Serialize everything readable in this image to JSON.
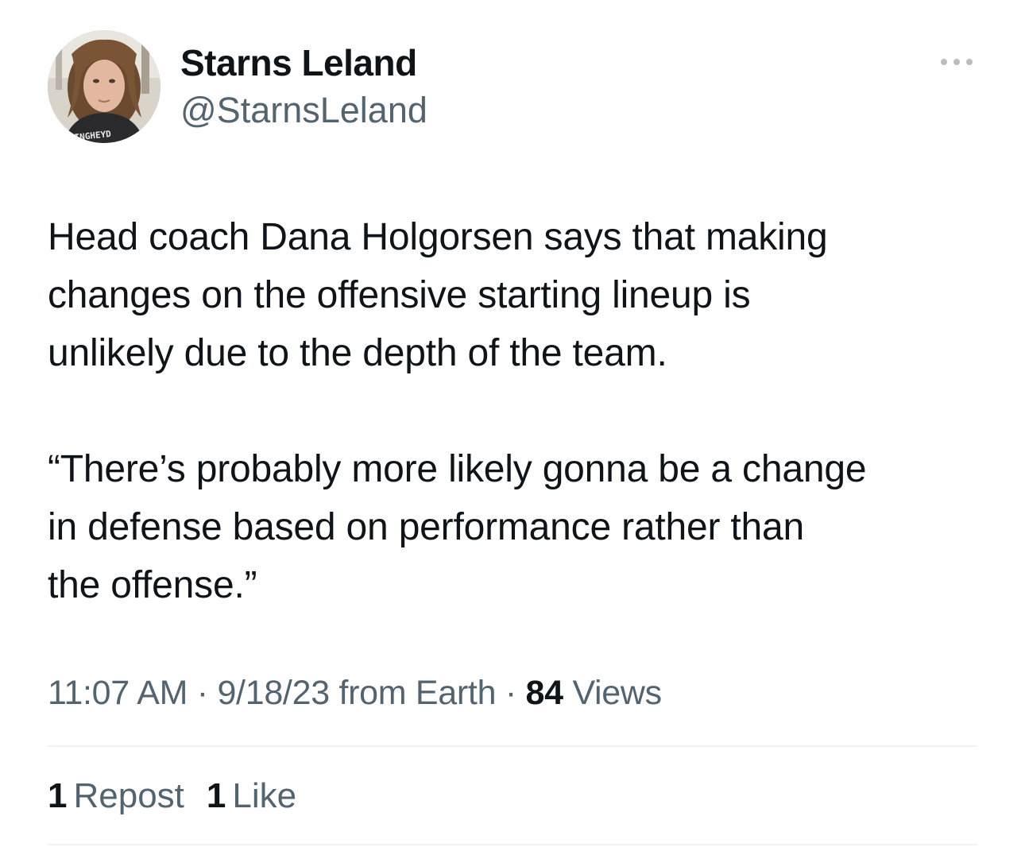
{
  "author": {
    "display_name": "Starns Leland",
    "handle": "@StarnsLeland",
    "avatar_shirt_text": "LKINGHEYD"
  },
  "tweet": {
    "paragraphs": [
      "Head coach Dana Holgorsen says that making\nchanges on the offensive starting lineup is\nunlikely due to the depth of the team.",
      "“There’s probably more likely gonna be a change\nin defense based on performance rather than\nthe offense.”"
    ]
  },
  "meta": {
    "time": "11:07 AM",
    "separator": "·",
    "date": "9/18/23",
    "source": "from Earth",
    "views_count": "84",
    "views_label": "Views"
  },
  "stats": {
    "reposts_count": "1",
    "reposts_label": "Repost",
    "likes_count": "1",
    "likes_label": "Like"
  },
  "icons": {
    "more": "more-horizontal-icon"
  },
  "colors": {
    "text_primary": "#0f1419",
    "text_secondary": "#536471",
    "divider": "#eff3f4"
  }
}
